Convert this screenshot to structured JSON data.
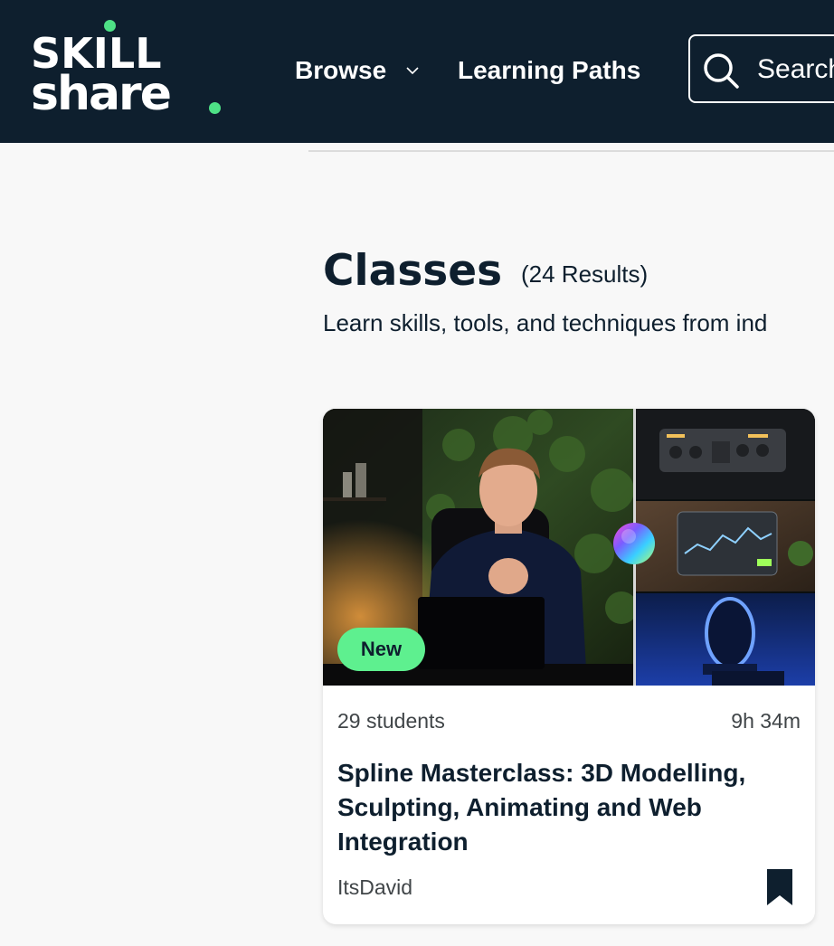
{
  "header": {
    "logo_line1": "SKILL",
    "logo_line2": "share",
    "logo_accent_color": "#4ee186",
    "background_color": "#0e1f2e",
    "nav": {
      "browse_label": "Browse",
      "learning_paths_label": "Learning Paths"
    },
    "search": {
      "placeholder": "Search",
      "icon": "search-icon"
    }
  },
  "main": {
    "title": "Classes",
    "results_count": "(24 Results)",
    "subtitle": "Learn skills, tools, and techniques from ind"
  },
  "classes": [
    {
      "badge": "New",
      "badge_color": "#5ef08f",
      "students": "29 students",
      "duration": "9h 34m",
      "title": "Spline Masterclass: 3D Modelling, Sculpting, Animating and Web Integration",
      "teacher": "ItsDavid",
      "bookmark_icon": "bookmark-icon"
    }
  ]
}
